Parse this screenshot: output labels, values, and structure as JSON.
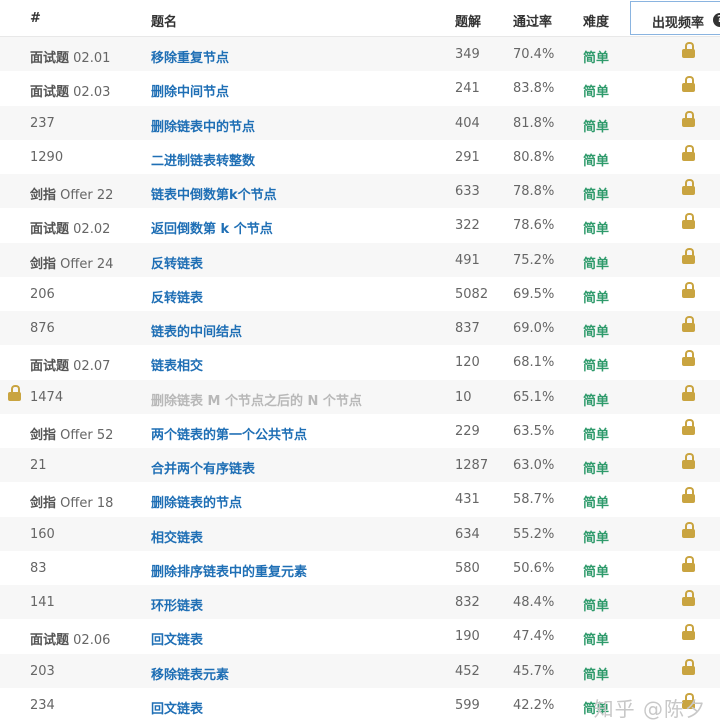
{
  "header": {
    "num": "#",
    "title": "题名",
    "solutions": "题解",
    "acceptance": "通过率",
    "difficulty": "难度",
    "frequency": "出现频率"
  },
  "rows": [
    {
      "prefix": "面试题",
      "id": "02.01",
      "title": "移除重复节点",
      "solutions": "349",
      "acceptance": "70.4%",
      "difficulty": "简单",
      "locked": false
    },
    {
      "prefix": "面试题",
      "id": "02.03",
      "title": "删除中间节点",
      "solutions": "241",
      "acceptance": "83.8%",
      "difficulty": "简单",
      "locked": false
    },
    {
      "prefix": "",
      "id": "237",
      "title": "删除链表中的节点",
      "solutions": "404",
      "acceptance": "81.8%",
      "difficulty": "简单",
      "locked": false
    },
    {
      "prefix": "",
      "id": "1290",
      "title": "二进制链表转整数",
      "solutions": "291",
      "acceptance": "80.8%",
      "difficulty": "简单",
      "locked": false
    },
    {
      "prefix": "剑指",
      "id": "Offer 22",
      "title": "链表中倒数第k个节点",
      "solutions": "633",
      "acceptance": "78.8%",
      "difficulty": "简单",
      "locked": false
    },
    {
      "prefix": "面试题",
      "id": "02.02",
      "title": "返回倒数第 k 个节点",
      "solutions": "322",
      "acceptance": "78.6%",
      "difficulty": "简单",
      "locked": false
    },
    {
      "prefix": "剑指",
      "id": "Offer 24",
      "title": "反转链表",
      "solutions": "491",
      "acceptance": "75.2%",
      "difficulty": "简单",
      "locked": false
    },
    {
      "prefix": "",
      "id": "206",
      "title": "反转链表",
      "solutions": "5082",
      "acceptance": "69.5%",
      "difficulty": "简单",
      "locked": false
    },
    {
      "prefix": "",
      "id": "876",
      "title": "链表的中间结点",
      "solutions": "837",
      "acceptance": "69.0%",
      "difficulty": "简单",
      "locked": false
    },
    {
      "prefix": "面试题",
      "id": "02.07",
      "title": "链表相交",
      "solutions": "120",
      "acceptance": "68.1%",
      "difficulty": "简单",
      "locked": false
    },
    {
      "prefix": "",
      "id": "1474",
      "title": "删除链表 M 个节点之后的 N 个节点",
      "solutions": "10",
      "acceptance": "65.1%",
      "difficulty": "简单",
      "locked": true
    },
    {
      "prefix": "剑指",
      "id": "Offer 52",
      "title": "两个链表的第一个公共节点",
      "solutions": "229",
      "acceptance": "63.5%",
      "difficulty": "简单",
      "locked": false
    },
    {
      "prefix": "",
      "id": "21",
      "title": "合并两个有序链表",
      "solutions": "1287",
      "acceptance": "63.0%",
      "difficulty": "简单",
      "locked": false
    },
    {
      "prefix": "剑指",
      "id": "Offer 18",
      "title": "删除链表的节点",
      "solutions": "431",
      "acceptance": "58.7%",
      "difficulty": "简单",
      "locked": false
    },
    {
      "prefix": "",
      "id": "160",
      "title": "相交链表",
      "solutions": "634",
      "acceptance": "55.2%",
      "difficulty": "简单",
      "locked": false
    },
    {
      "prefix": "",
      "id": "83",
      "title": "删除排序链表中的重复元素",
      "solutions": "580",
      "acceptance": "50.6%",
      "difficulty": "简单",
      "locked": false
    },
    {
      "prefix": "",
      "id": "141",
      "title": "环形链表",
      "solutions": "832",
      "acceptance": "48.4%",
      "difficulty": "简单",
      "locked": false
    },
    {
      "prefix": "面试题",
      "id": "02.06",
      "title": "回文链表",
      "solutions": "190",
      "acceptance": "47.4%",
      "difficulty": "简单",
      "locked": false
    },
    {
      "prefix": "",
      "id": "203",
      "title": "移除链表元素",
      "solutions": "452",
      "acceptance": "45.7%",
      "difficulty": "简单",
      "locked": false
    },
    {
      "prefix": "",
      "id": "234",
      "title": "回文链表",
      "solutions": "599",
      "acceptance": "42.2%",
      "difficulty": "简单",
      "locked": false
    }
  ],
  "icons": {
    "frequency_cell": "lock-icon",
    "help": "question-circle-icon"
  },
  "colors": {
    "title_link": "#1f6fb5",
    "difficulty_easy": "#2e9a6b",
    "lock": "#c9a440",
    "locked_title": "#b8b8b8"
  },
  "watermark": "知乎 @陈夕"
}
